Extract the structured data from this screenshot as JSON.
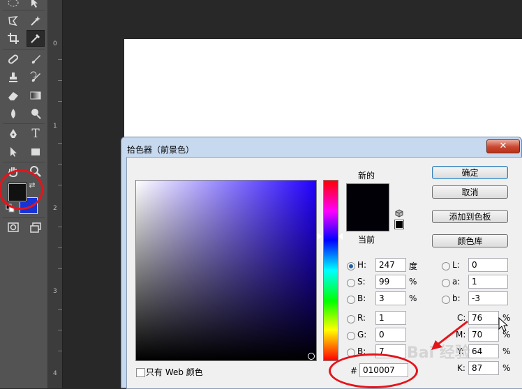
{
  "toolbar": {
    "tools": [
      "marquee-tool",
      "move-tool",
      "lasso-tool",
      "magic-wand-tool",
      "crop-tool",
      "eyedropper-tool",
      "healing-brush-tool",
      "brush-tool",
      "clone-stamp-tool",
      "history-brush-tool",
      "eraser-tool",
      "gradient-tool",
      "blur-tool",
      "dodge-tool",
      "pen-tool",
      "type-tool",
      "path-selection-tool",
      "shape-tool",
      "hand-tool",
      "zoom-tool"
    ],
    "type_glyph": "T"
  },
  "ruler": {
    "marks": [
      "0",
      "1",
      "2",
      "3",
      "4"
    ]
  },
  "dialog": {
    "title": "拾色器（前景色）",
    "close": "✕",
    "label_new": "新的",
    "label_current": "当前",
    "new_color": "#010007",
    "current_color": "#010007",
    "buttons": {
      "ok": "确定",
      "cancel": "取消",
      "add_swatches": "添加到色板",
      "color_libraries": "颜色库"
    },
    "hsb": {
      "h": {
        "label": "H:",
        "value": "247",
        "unit": "度",
        "selected": true
      },
      "s": {
        "label": "S:",
        "value": "99",
        "unit": "%"
      },
      "b": {
        "label": "B:",
        "value": "3",
        "unit": "%"
      }
    },
    "rgb": {
      "r": {
        "label": "R:",
        "value": "1"
      },
      "g": {
        "label": "G:",
        "value": "0"
      },
      "b": {
        "label": "B:",
        "value": "7"
      }
    },
    "lab": {
      "l": {
        "label": "L:",
        "value": "0"
      },
      "a": {
        "label": "a:",
        "value": "1"
      },
      "b": {
        "label": "b:",
        "value": "-3"
      }
    },
    "cmyk": {
      "c": {
        "label": "C:",
        "value": "76",
        "unit": "%"
      },
      "m": {
        "label": "M:",
        "value": "70",
        "unit": "%"
      },
      "y": {
        "label": "Y:",
        "value": "64",
        "unit": "%"
      },
      "k": {
        "label": "K:",
        "value": "87",
        "unit": "%"
      }
    },
    "web_only_label": "只有 Web 颜色",
    "hex_label": "#",
    "hex_value": "010007"
  },
  "watermark": "Bai 经验",
  "colors": {
    "foreground": "#111111",
    "background": "#1733d6",
    "annotation": "#e5141b"
  }
}
